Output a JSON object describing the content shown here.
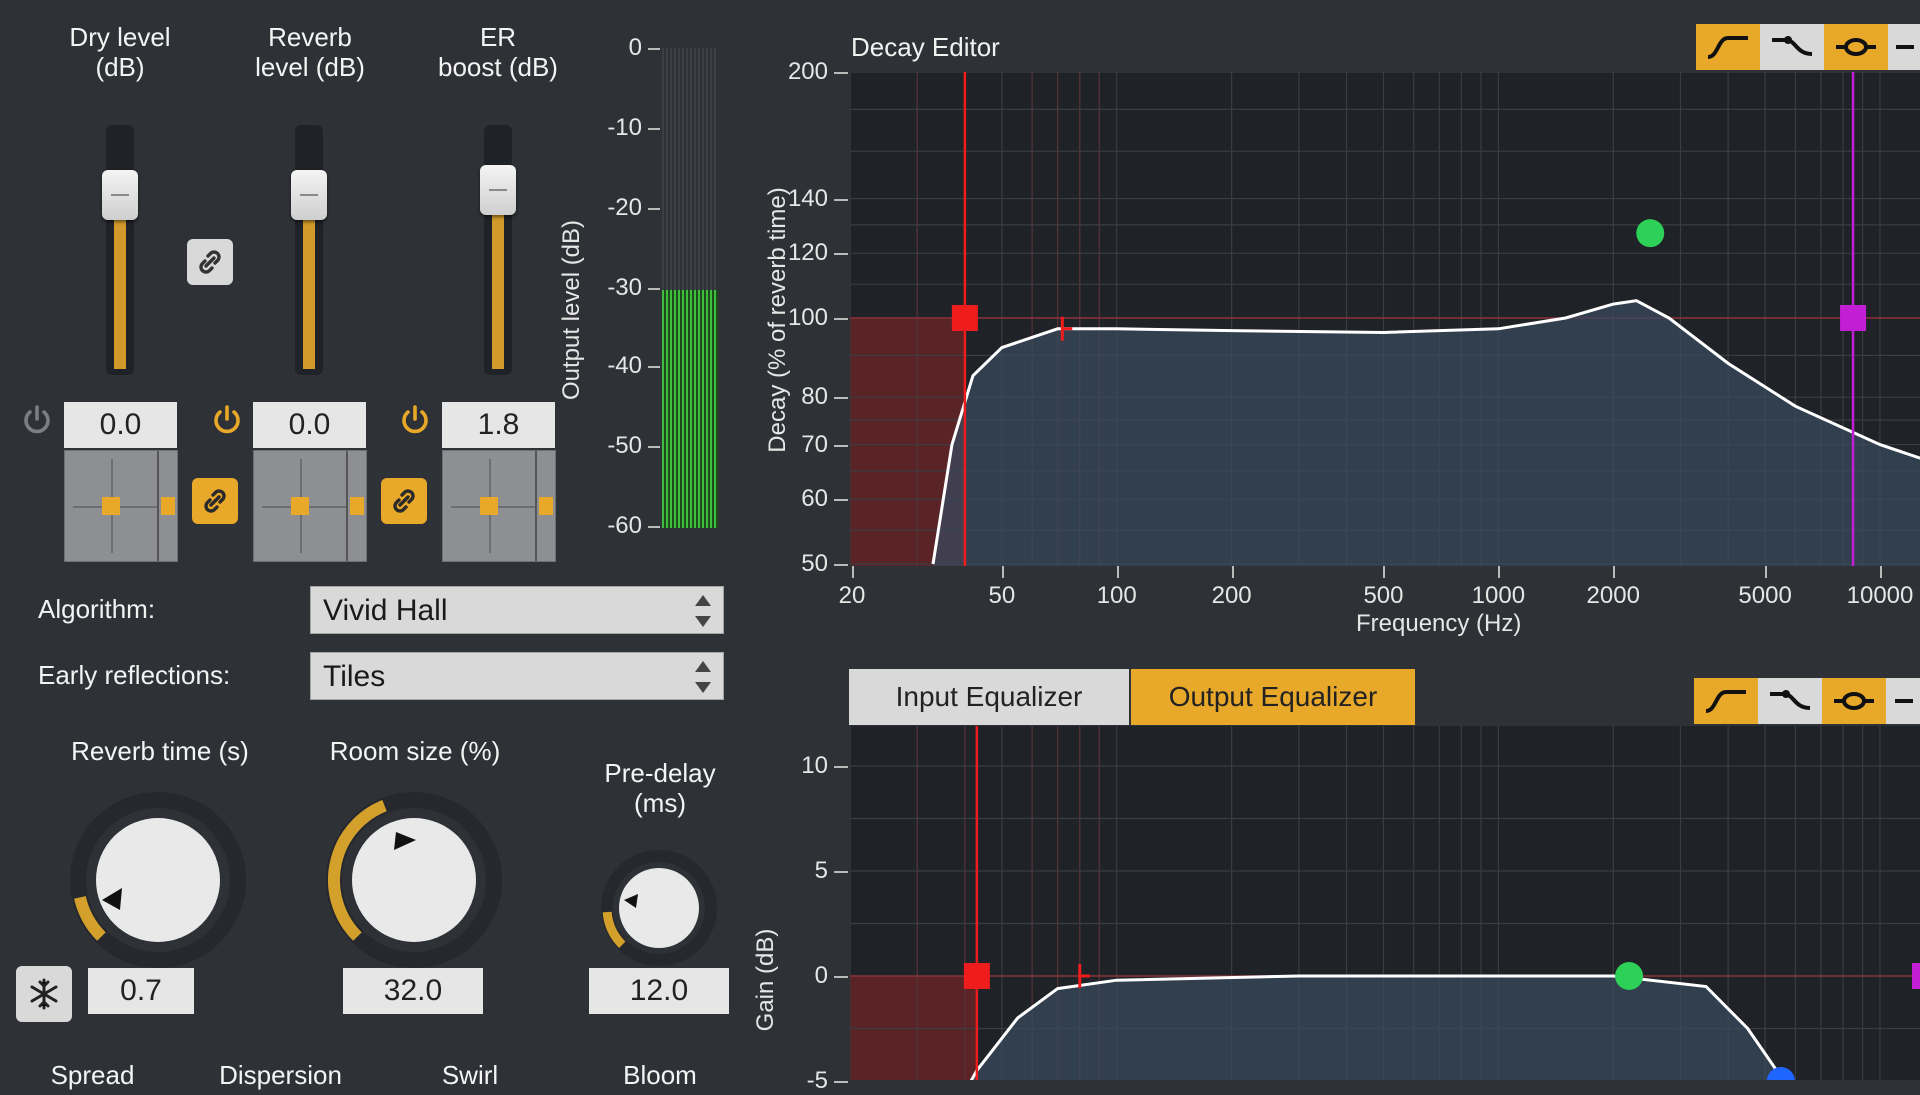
{
  "faders": [
    {
      "title": "Dry level\n(dB)",
      "value": "0.0",
      "level": 0.72,
      "power_on": false
    },
    {
      "title": "Reverb\nlevel (dB)",
      "value": "0.0",
      "level": 0.72,
      "power_on": true
    },
    {
      "title": "ER\nboost (dB)",
      "value": "1.8",
      "level": 0.75,
      "power_on": true
    }
  ],
  "meter": {
    "label": "Output level (dB)",
    "ticks": [
      "0",
      "-10",
      "-20",
      "-30",
      "-40",
      "-50",
      "-60"
    ]
  },
  "algorithm": {
    "label": "Algorithm:",
    "value": "Vivid Hall"
  },
  "early_reflections": {
    "label": "Early reflections:",
    "value": "Tiles"
  },
  "knobs": [
    {
      "title": "Reverb time (s)",
      "value": "0.7",
      "amount": 0.12
    },
    {
      "title": "Room size (%)",
      "value": "32.0",
      "amount": 0.42
    },
    {
      "title": "Pre-delay\n(ms)",
      "value": "12.0",
      "amount": 0.15
    }
  ],
  "bottom_labels": [
    "Spread",
    "Dispersion",
    "Swirl",
    "Bloom"
  ],
  "decay_editor": {
    "title": "Decay Editor",
    "ylabel": "Decay (% of reverb time)",
    "xlabel": "Frequency (Hz)",
    "yticks": [
      "200",
      "140",
      "120",
      "100",
      "80",
      "70",
      "60",
      "50"
    ],
    "xticks": [
      "20",
      "50",
      "100",
      "200",
      "500",
      "1000",
      "2000",
      "5000",
      "10000"
    ]
  },
  "eq": {
    "tabs": [
      "Input Equalizer",
      "Output Equalizer"
    ],
    "active_tab": 1,
    "ylabel": "Gain (dB)",
    "yticks": [
      "10",
      "5",
      "0",
      "-5"
    ]
  },
  "colors": {
    "accent": "#e8a829",
    "meter": "#3fbf3f",
    "curve": "#ffffff",
    "red_marker": "#ee1c1c",
    "green_marker": "#2ed158",
    "magenta_marker": "#c21ed6",
    "blue_marker": "#1e66ff"
  },
  "icons": {
    "link": "link-icon",
    "power": "power-icon",
    "freeze": "snowflake-icon"
  }
}
